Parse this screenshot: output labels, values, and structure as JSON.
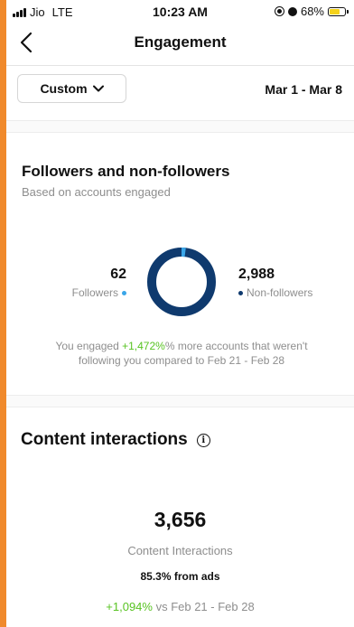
{
  "status_bar": {
    "carrier": "Jio",
    "network": "LTE",
    "time": "10:23 AM",
    "battery": "68%",
    "battery_level": 0.68
  },
  "header": {
    "title": "Engagement",
    "back_icon": "chevron-left-icon"
  },
  "filter": {
    "custom_label": "Custom",
    "date_range": "Mar 1 - Mar 8"
  },
  "followers": {
    "title": "Followers and non-followers",
    "subtitle": "Based on accounts engaged",
    "followers_value": "62",
    "followers_label": "Followers",
    "non_followers_value": "2,988",
    "non_followers_label": "Non-followers",
    "followers_color": "#3aa6e8",
    "non_followers_color": "#0f3a6e",
    "note_prefix": "You engaged ",
    "note_change": "+1,472%",
    "note_suffix": "% more accounts that weren't following you compared to Feb 21 - Feb 28"
  },
  "content_interactions": {
    "title": "Content interactions",
    "info_icon": "info-icon",
    "value": "3,656",
    "label": "Content Interactions",
    "ads": "85.3% from ads",
    "change": "+1,094%",
    "change_suffix": " vs Feb 21 - Feb 28"
  },
  "colors": {
    "positive": "#58c322",
    "page_border": "#f08a2c"
  }
}
